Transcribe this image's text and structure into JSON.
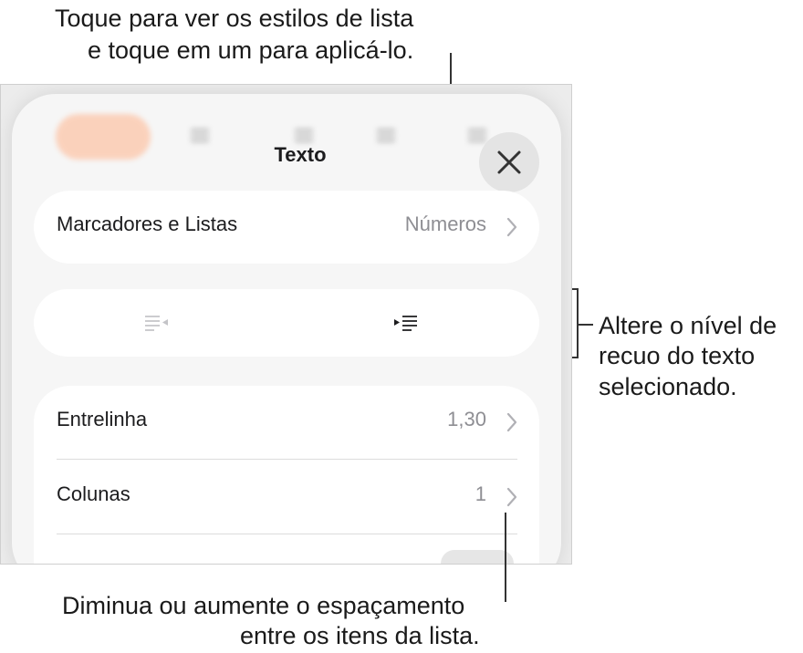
{
  "callouts": {
    "top_line1": "Toque para ver os estilos de lista",
    "top_line2": "e toque em um para aplicá-lo.",
    "right_line1": "Altere o nível de",
    "right_line2": "recuo do texto",
    "right_line3": "selecionado.",
    "bottom_line1": "Diminua ou aumente o espaçamento",
    "bottom_line2": "entre os itens da lista."
  },
  "panel": {
    "title": "Texto",
    "close_icon": "close-icon",
    "bullets_row": {
      "label": "Marcadores e Listas",
      "value": "Números"
    },
    "indent": {
      "decrease_icon": "outdent-icon",
      "increase_icon": "indent-icon"
    },
    "line_spacing_row": {
      "label": "Entrelinha",
      "value": "1,30"
    },
    "columns_row": {
      "label": "Colunas",
      "value": "1"
    }
  },
  "colors": {
    "accent_blurred": "#ffb48c",
    "panel_bg": "#f6f6f6",
    "secondary_text": "#8e8e93"
  }
}
